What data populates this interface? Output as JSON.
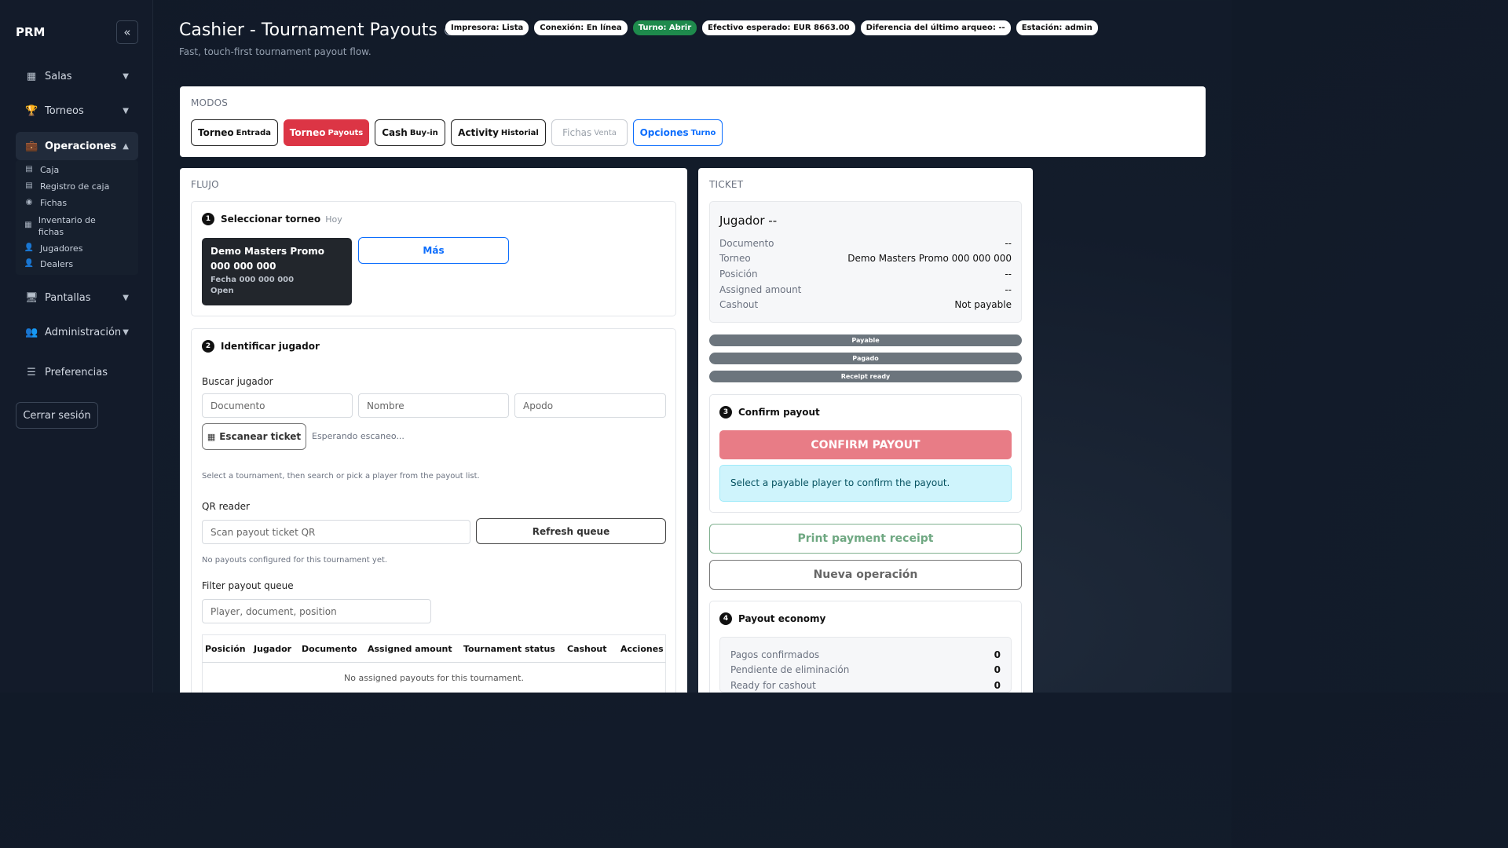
{
  "sidebar": {
    "brand": "PRM",
    "collapse_icon": "«",
    "items": [
      {
        "label": "Salas",
        "icon": "▦"
      },
      {
        "label": "Torneos",
        "icon": "🏆"
      },
      {
        "label": "Operaciones",
        "icon": "💼"
      },
      {
        "label": "Pantallas",
        "icon": "🖥"
      },
      {
        "label": "Administración",
        "icon": "👥"
      },
      {
        "label": "Preferencias",
        "icon": "☰"
      }
    ],
    "sub_items": [
      {
        "label": "Caja",
        "icon": "▤"
      },
      {
        "label": "Registro de caja",
        "icon": "▤"
      },
      {
        "label": "Fichas",
        "icon": "◉"
      },
      {
        "label": "Inventario de fichas",
        "icon": "▦"
      },
      {
        "label": "Jugadores",
        "icon": "👤"
      },
      {
        "label": "Dealers",
        "icon": "👤"
      }
    ],
    "logout_label": "Cerrar sesión"
  },
  "header": {
    "title": "Cashier - Tournament Payouts",
    "subtitle": "Fast, touch-first tournament payout flow.",
    "badges": [
      "Impresora: Lista",
      "Conexión: En línea",
      "Turno: Abrir",
      "Efectivo esperado: EUR 8663.00",
      "Diferencia del último arqueo: --",
      "Estación: admin"
    ]
  },
  "modes": {
    "label": "MODOS",
    "buttons": [
      {
        "main": "Torneo",
        "small": "Entrada"
      },
      {
        "main": "Torneo",
        "small": "Payouts"
      },
      {
        "main": "Cash",
        "small": "Buy-in"
      },
      {
        "main": "Activity",
        "small": "Historial"
      },
      {
        "main": "Fichas",
        "small": "Venta"
      },
      {
        "main": "Opciones",
        "small": "Turno"
      }
    ]
  },
  "flow": {
    "label": "FLUJO",
    "step1": {
      "num": "1",
      "title": "Seleccionar torneo",
      "muted": "Hoy",
      "tournament": {
        "name": "Demo Masters Promo 000 000 000",
        "date": "Fecha 000 000 000",
        "status": "Open"
      },
      "more_label": "Más"
    },
    "step2": {
      "num": "2",
      "title": "Identificar jugador",
      "search_label": "Buscar jugador",
      "placeholders": {
        "documento": "Documento",
        "nombre": "Nombre",
        "apodo": "Apodo"
      },
      "scan_label": "Escanear ticket",
      "scan_status": "Esperando escaneo...",
      "hint": "Select a tournament, then search or pick a player from the payout list.",
      "qr_label": "QR reader",
      "qr_placeholder": "Scan payout ticket QR",
      "refresh_label": "Refresh queue",
      "no_payouts": "No payouts configured for this tournament yet.",
      "filter_label": "Filter payout queue",
      "filter_placeholder": "Player, document, position",
      "columns": [
        "Posición",
        "Jugador",
        "Documento",
        "Assigned amount",
        "Tournament status",
        "Cashout",
        "Acciones"
      ],
      "empty": "No assigned payouts for this tournament."
    }
  },
  "ticket": {
    "label": "TICKET",
    "player": "Jugador --",
    "rows": [
      {
        "k": "Documento",
        "v": "--"
      },
      {
        "k": "Torneo",
        "v": "Demo Masters Promo 000 000 000"
      },
      {
        "k": "Posición",
        "v": "--"
      },
      {
        "k": "Assigned amount",
        "v": "--"
      },
      {
        "k": "Cashout",
        "v": "Not payable"
      }
    ],
    "pills": [
      "Payable",
      "Pagado",
      "Receipt ready"
    ],
    "step3": {
      "num": "3",
      "title": "Confirm payout",
      "button": "CONFIRM PAYOUT",
      "info": "Select a payable player to confirm the payout."
    },
    "print_label": "Print payment receipt",
    "new_label": "Nueva operación",
    "step4": {
      "num": "4",
      "title": "Payout economy",
      "rows": [
        {
          "k": "Pagos confirmados",
          "v": "0"
        },
        {
          "k": "Pendiente de eliminación",
          "v": "0"
        },
        {
          "k": "Ready for cashout",
          "v": "0"
        }
      ]
    }
  }
}
